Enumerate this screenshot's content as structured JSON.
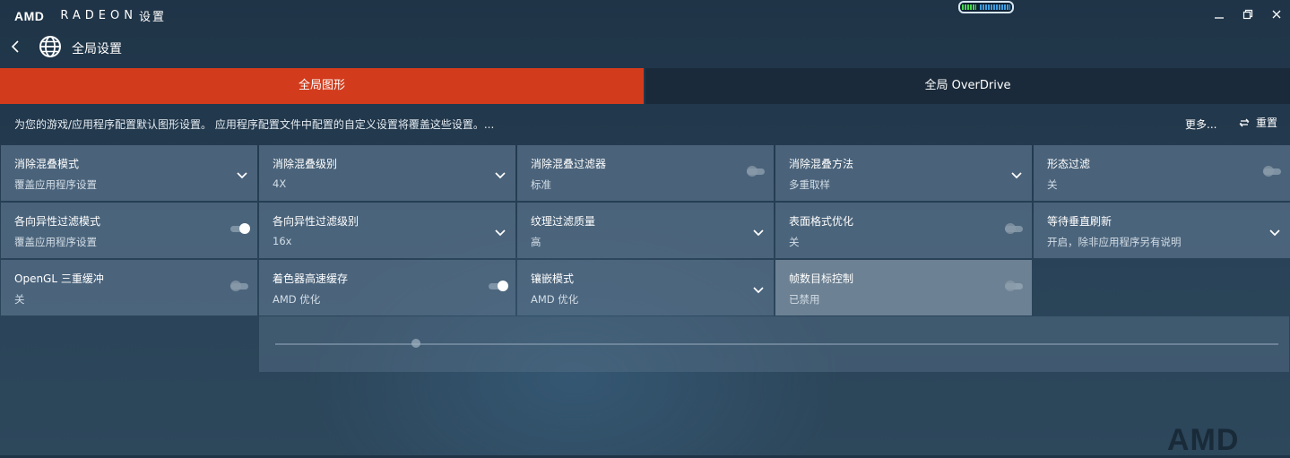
{
  "app": {
    "brand": "AMD",
    "product": "RADEON",
    "settings_word": "设置"
  },
  "battery": {
    "level": 0.28,
    "colors": {
      "charged": "#46d64b",
      "remaining": "#3d9de0"
    }
  },
  "window_controls": [
    "minimize-icon",
    "maximize-icon",
    "close-icon"
  ],
  "nav": {
    "title": "全局设置",
    "back_icon": "chevron-left-icon",
    "page_icon": "globe-icon"
  },
  "tabs": [
    {
      "label": "全局图形",
      "active": true
    },
    {
      "label": "全局 OverDrive",
      "active": false
    }
  ],
  "description": "为您的游戏/应用程序配置默认图形设置。 应用程序配置文件中配置的自定义设置将覆盖这些设置。...",
  "more_label": "更多...",
  "reset_label": "重置",
  "accent_color": "#d23c1d",
  "settings": [
    {
      "label": "消除混叠模式",
      "value": "覆盖应用程序设置",
      "control": "dropdown"
    },
    {
      "label": "消除混叠级别",
      "value": "4X",
      "control": "dropdown"
    },
    {
      "label": "消除混叠过滤器",
      "value": "标准",
      "control": "toggle",
      "on": false
    },
    {
      "label": "消除混叠方法",
      "value": "多重取样",
      "control": "dropdown"
    },
    {
      "label": "形态过滤",
      "value": "关",
      "control": "toggle",
      "on": false
    },
    {
      "label": "各向异性过滤模式",
      "value": "覆盖应用程序设置",
      "control": "toggle",
      "on": true
    },
    {
      "label": "各向异性过滤级别",
      "value": "16x",
      "control": "dropdown"
    },
    {
      "label": "纹理过滤质量",
      "value": "高",
      "control": "dropdown"
    },
    {
      "label": "表面格式优化",
      "value": "关",
      "control": "toggle",
      "on": false
    },
    {
      "label": "等待垂直刷新",
      "value": "开启，除非应用程序另有说明",
      "control": "dropdown"
    },
    {
      "label": "OpenGL 三重缓冲",
      "value": "关",
      "control": "toggle",
      "on": false
    },
    {
      "label": "着色器高速缓存",
      "value": "AMD 优化",
      "control": "toggle",
      "on": true
    },
    {
      "label": "镶嵌模式",
      "value": "AMD 优化",
      "control": "dropdown"
    },
    {
      "label": "帧数目标控制",
      "value": "已禁用",
      "control": "toggle",
      "on": false
    }
  ],
  "watermark": "AMD"
}
